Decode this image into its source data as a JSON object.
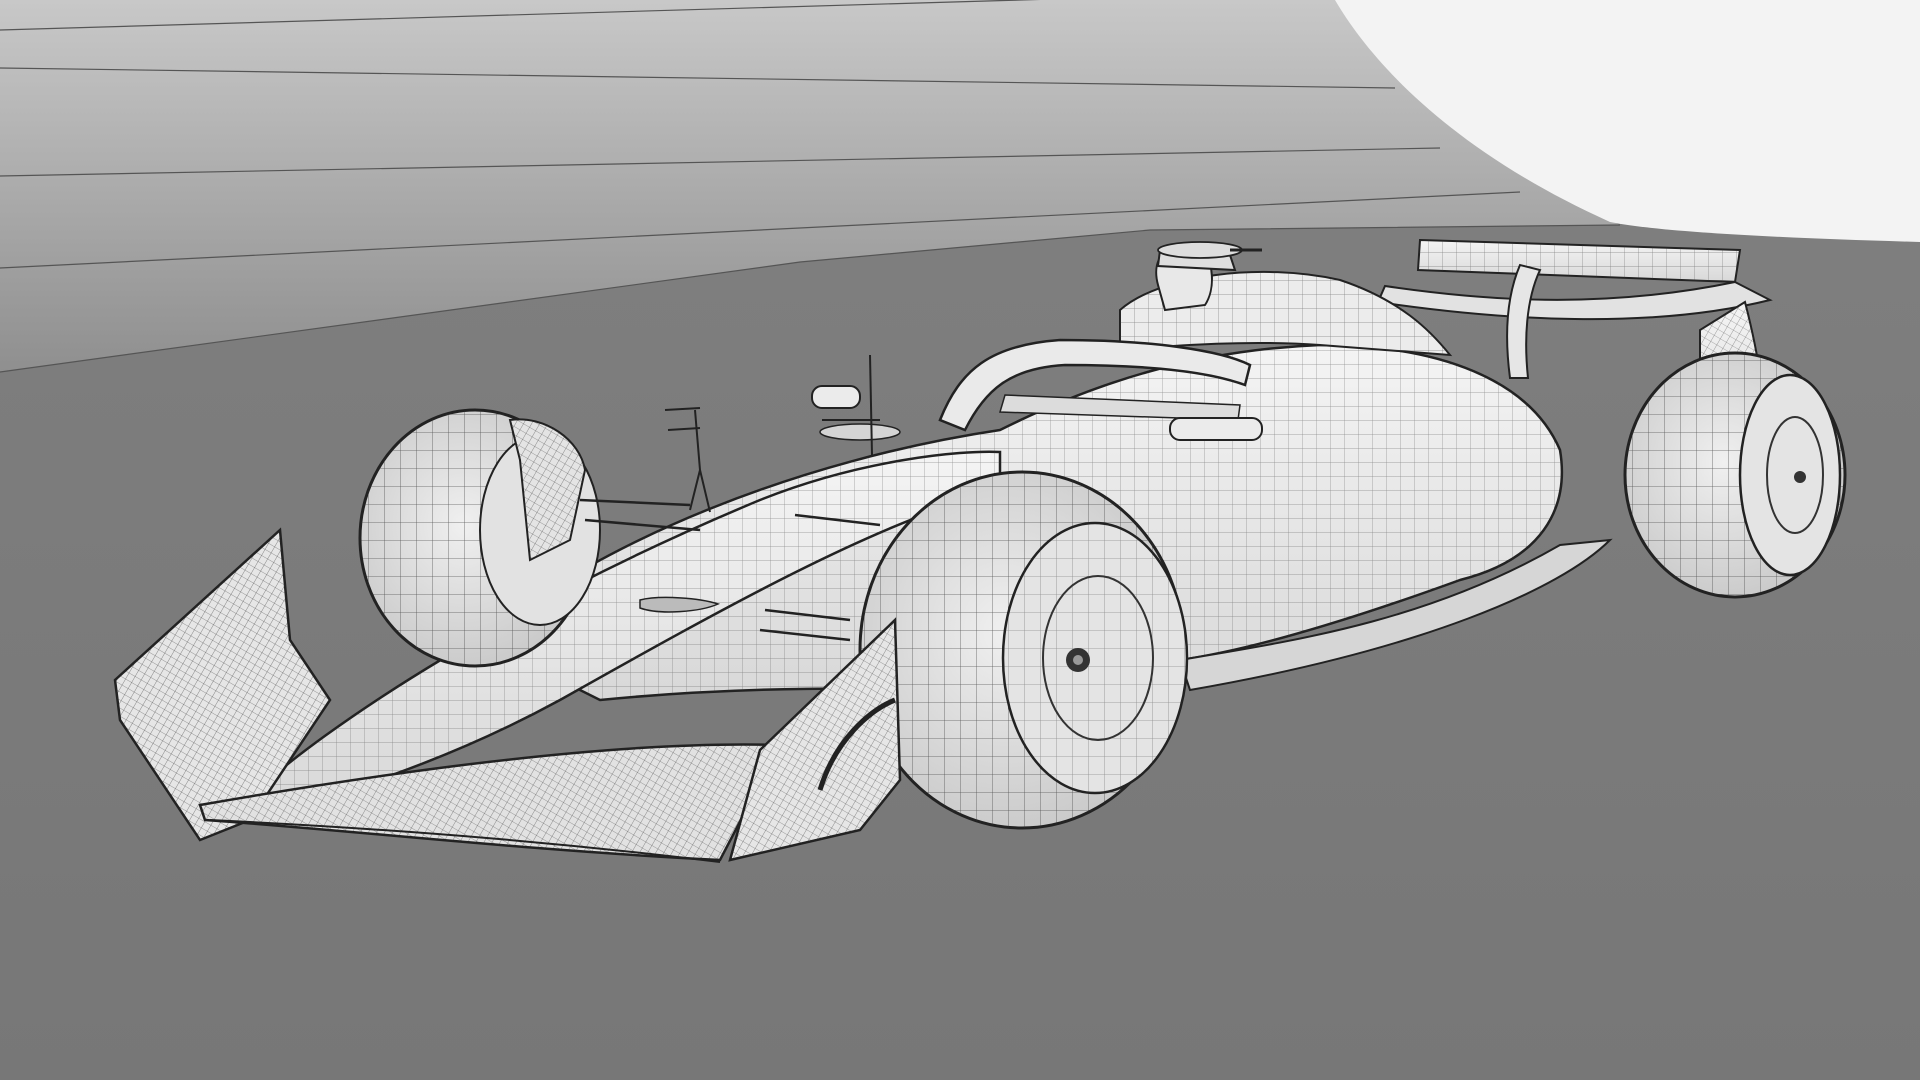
{
  "scene": {
    "subject": "wireframe-formula-one-car",
    "colors": {
      "floor": "#7d7d7d",
      "wall_top": "#c9c9c9",
      "wall_bottom": "#8e8e8e",
      "backdrop_curve": "#f2f2f2",
      "body_fill": "#e9e9e9",
      "wire": "#2a2a2a",
      "tire_fill": "#dcdcdc"
    }
  }
}
